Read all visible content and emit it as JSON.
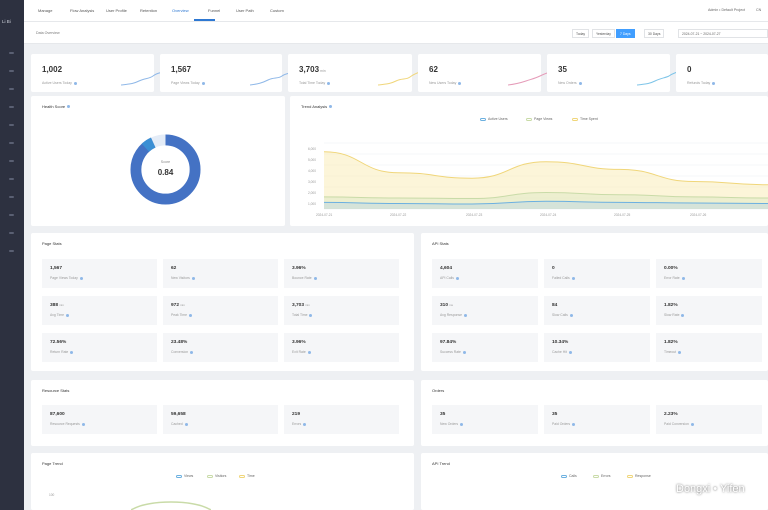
{
  "sidebar": {
    "logo": "Li Bi"
  },
  "topnav": {
    "tabs": [
      {
        "label": "Manage"
      },
      {
        "label": "Flow Analysis"
      },
      {
        "label": "User Profile"
      },
      {
        "label": "Retention"
      },
      {
        "label": "Overview"
      },
      {
        "label": "Funnel"
      },
      {
        "label": "User Path"
      },
      {
        "label": "Custom"
      }
    ],
    "user": "Admin • Default Project",
    "lang": "CN"
  },
  "filterbar": {
    "breadcrumb": "Data Overview",
    "ranges": [
      "Today",
      "Yesterday",
      "7 Days",
      "30 Days"
    ],
    "active_range": "7 Days",
    "date_range": "2024-07-21  ~  2024-07-27"
  },
  "kpis": [
    {
      "value": "1,002",
      "unit": "",
      "label": "Active Users Today",
      "color": "#8fb8e8"
    },
    {
      "value": "1,567",
      "unit": "",
      "label": "Page Views Today",
      "color": "#8fb8e8"
    },
    {
      "value": "3,703",
      "unit": "min",
      "label": "Total Time Today",
      "color": "#f0d67a"
    },
    {
      "value": "62",
      "unit": "",
      "label": "New Users Today",
      "color": "#e59bb8"
    },
    {
      "value": "35",
      "unit": "",
      "label": "New Orders",
      "color": "#7dc4e8"
    },
    {
      "value": "0",
      "unit": "",
      "label": "Refunds Today",
      "color": "#8fb8e8"
    }
  ],
  "donut": {
    "title": "Health Score",
    "label": "Score",
    "value": "0.84",
    "fraction": 0.93
  },
  "trend": {
    "title": "Trend Analysis",
    "legend": [
      "Active Users",
      "Page Views",
      "Time Spent"
    ],
    "yticks": [
      "6,000",
      "5,000",
      "4,000",
      "3,000",
      "2,000",
      "1,000",
      "0"
    ],
    "xticks": [
      "2024-07-21",
      "2024-07-22",
      "2024-07-23",
      "2024-07-24",
      "2024-07-25",
      "2024-07-26"
    ]
  },
  "chart_data": {
    "type": "area",
    "x": [
      "07-21",
      "07-22",
      "07-23",
      "07-24",
      "07-25",
      "07-26",
      "07-27"
    ],
    "ylim": [
      0,
      6000
    ],
    "series": [
      {
        "name": "Time Spent",
        "values": [
          5200,
          3300,
          2800,
          4300,
          3600,
          2500,
          2200
        ]
      },
      {
        "name": "Page Views",
        "values": [
          1100,
          1000,
          950,
          1500,
          1300,
          1100,
          1000
        ]
      },
      {
        "name": "Active Users",
        "values": [
          600,
          500,
          450,
          700,
          600,
          550,
          500
        ]
      }
    ]
  },
  "page_stats": {
    "title": "Page Stats",
    "cells": [
      {
        "value": "1,567",
        "unit": "",
        "label": "Page Views Today"
      },
      {
        "value": "62",
        "unit": "",
        "label": "New Visitors"
      },
      {
        "value": "3.96%",
        "unit": "",
        "label": "Bounce Rate"
      },
      {
        "value": "388",
        "unit": "min",
        "label": "Avg Time"
      },
      {
        "value": "972",
        "unit": "min",
        "label": "Peak Time"
      },
      {
        "value": "3,703",
        "unit": "min",
        "label": "Total Time"
      },
      {
        "value": "72.56%",
        "unit": "",
        "label": "Return Rate"
      },
      {
        "value": "23.48%",
        "unit": "",
        "label": "Conversion"
      },
      {
        "value": "3.96%",
        "unit": "",
        "label": "Exit Rate"
      }
    ]
  },
  "api_stats": {
    "title": "API Stats",
    "cells": [
      {
        "value": "4,604",
        "unit": "",
        "label": "API Calls"
      },
      {
        "value": "0",
        "unit": "",
        "label": "Failed Calls"
      },
      {
        "value": "0.00%",
        "unit": "",
        "label": "Error Rate"
      },
      {
        "value": "310",
        "unit": "ms",
        "label": "Avg Response"
      },
      {
        "value": "84",
        "unit": "",
        "label": "Slow Calls"
      },
      {
        "value": "1.82%",
        "unit": "",
        "label": "Slow Rate"
      },
      {
        "value": "97.84%",
        "unit": "",
        "label": "Success Rate"
      },
      {
        "value": "10.34%",
        "unit": "",
        "label": "Cache Hit"
      },
      {
        "value": "1.82%",
        "unit": "",
        "label": "Timeout"
      }
    ]
  },
  "resource_stats": {
    "title": "Resource Stats",
    "cells": [
      {
        "value": "87,600",
        "unit": "",
        "label": "Resource Requests"
      },
      {
        "value": "59,658",
        "unit": "",
        "label": "Cached"
      },
      {
        "value": "219",
        "unit": "",
        "label": "Errors"
      }
    ]
  },
  "order_stats": {
    "title": "Orders",
    "cells": [
      {
        "value": "35",
        "unit": "",
        "label": "New Orders"
      },
      {
        "value": "35",
        "unit": "",
        "label": "Paid Orders"
      },
      {
        "value": "2.23%",
        "unit": "",
        "label": "Paid Conversion"
      }
    ]
  },
  "bottom_left": {
    "title": "Page Trend",
    "legend": [
      "Views",
      "Visitors",
      "Time"
    ],
    "ytick": "100"
  },
  "bottom_right": {
    "title": "API Trend",
    "legend": [
      "Calls",
      "Errors",
      "Response"
    ]
  },
  "watermark": "Dongxi • Yifen"
}
